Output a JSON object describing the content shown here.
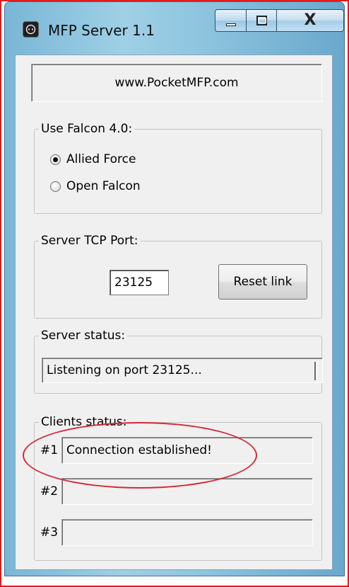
{
  "window": {
    "title": "MFP Server 1.1",
    "icon": "mfp-app-icon",
    "buttons": {
      "minimize_icon": "minimize-icon",
      "maximize_icon": "maximize-icon",
      "close_glyph": "X"
    }
  },
  "url_box": {
    "text": "www.PocketMFP.com"
  },
  "falcon_group": {
    "label": "Use Falcon 4.0:",
    "options": [
      {
        "label": "Allied Force",
        "checked": true
      },
      {
        "label": "Open Falcon",
        "checked": false
      }
    ]
  },
  "port_group": {
    "label": "Server TCP Port:",
    "port_value": "23125",
    "reset_label": "Reset link"
  },
  "server_status": {
    "label": "Server status:",
    "text": "Listening on port 23125..."
  },
  "clients_status": {
    "label": "Clients status:",
    "clients": [
      {
        "num": "#1",
        "status": "Connection established!"
      },
      {
        "num": "#2",
        "status": ""
      },
      {
        "num": "#3",
        "status": ""
      }
    ]
  },
  "colors": {
    "annotation_red": "#d4283a",
    "frame_red": "#e01b1b",
    "aero_blue": "#8cc3de"
  }
}
